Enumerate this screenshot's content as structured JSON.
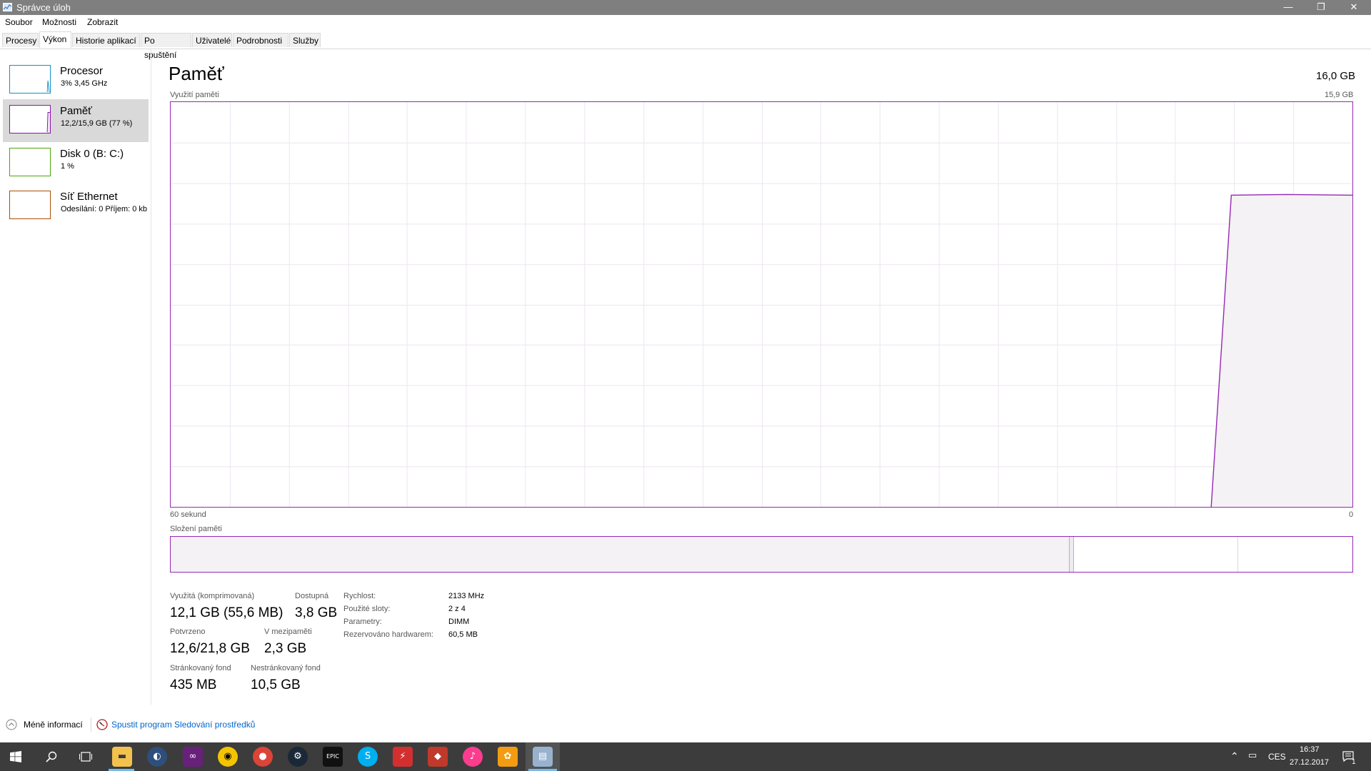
{
  "window": {
    "title": "Správce úloh",
    "minimize": "—",
    "restore": "❐",
    "close": "✕"
  },
  "menu": [
    "Soubor",
    "Možnosti",
    "Zobrazit"
  ],
  "tabs": [
    "Procesy",
    "Výkon",
    "Historie aplikací",
    "Po spuštění",
    "Uživatelé",
    "Podrobnosti",
    "Služby"
  ],
  "active_tab": "Výkon",
  "sidebar": {
    "items": [
      {
        "title": "Procesor",
        "subtitle": "3% 3,45 GHz",
        "color": "#1191c8"
      },
      {
        "title": "Paměť",
        "subtitle": "12,2/15,9 GB (77 %)",
        "color": "#8b12ae"
      },
      {
        "title": "Disk 0 (B: C:)",
        "subtitle": "1 %",
        "color": "#4da60c"
      },
      {
        "title": "Síť Ethernet",
        "subtitle": "Odesílání: 0 Příjem: 0 kb",
        "color": "#a74f01"
      }
    ]
  },
  "memory": {
    "heading": "Paměť",
    "total": "16,0 GB",
    "usage_label": "Využití paměti",
    "usage_max": "15,9 GB",
    "time_left": "60 sekund",
    "time_right": "0",
    "composition_label": "Složení paměti",
    "usage_fraction_now": 0.77,
    "stats": {
      "in_use_label": "Využitá (komprimovaná)",
      "in_use_value": "12,1 GB (55,6 MB)",
      "available_label": "Dostupná",
      "available_value": "3,8 GB",
      "committed_label": "Potvrzeno",
      "committed_value": "12,6/21,8 GB",
      "cached_label": "V mezipaměti",
      "cached_value": "2,3 GB",
      "paged_label": "Stránkovaný fond",
      "paged_value": "435 MB",
      "nonpaged_label": "Nestránkovaný fond",
      "nonpaged_value": "10,5 GB"
    },
    "details": [
      {
        "label": "Rychlost:",
        "value": "2133 MHz"
      },
      {
        "label": "Použité sloty:",
        "value": "2 z 4"
      },
      {
        "label": "Parametry:",
        "value": "DIMM"
      },
      {
        "label": "Rezervováno hardwarem:",
        "value": "60,5 MB"
      }
    ],
    "accent_color": "#9528b4",
    "fill_color": "#f4f2f4"
  },
  "footer": {
    "fewer_details": "Méně informací",
    "resource_monitor": "Spustit program Sledování prostředků"
  },
  "taskbar": {
    "apps": [
      "start-icon",
      "search-icon",
      "task-view-icon",
      "file-explorer-icon",
      "app-icon",
      "visual-studio-icon",
      "app-icon",
      "chrome-icon",
      "steam-icon",
      "epic-games-icon",
      "skype-icon",
      "app-icon",
      "app-icon",
      "itunes-icon",
      "fl-studio-icon",
      "task-manager-icon"
    ],
    "language": "CES",
    "time": "16:37",
    "date": "27.12.2017",
    "notifications": "1"
  }
}
